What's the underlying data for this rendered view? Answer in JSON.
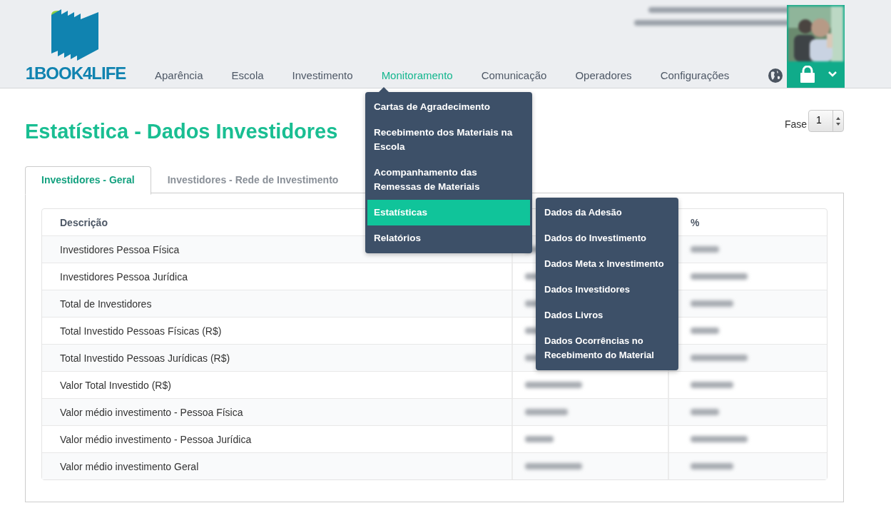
{
  "logo": {
    "text": "1BOOK4LIFE"
  },
  "nav": [
    {
      "label": "Aparência",
      "selected": false
    },
    {
      "label": "Escola",
      "selected": false
    },
    {
      "label": "Investimento",
      "selected": false
    },
    {
      "label": "Monitoramento",
      "selected": true
    },
    {
      "label": "Comunicação",
      "selected": false
    },
    {
      "label": "Operadores",
      "selected": false
    },
    {
      "label": "Configurações",
      "selected": false
    }
  ],
  "menu": {
    "items": [
      {
        "label": "Cartas de Agradecimento",
        "selected": false
      },
      {
        "label": "Recebimento dos Materiais na Escola",
        "selected": false
      },
      {
        "label": "Acompanhamento das Remessas de Materiais",
        "selected": false
      },
      {
        "label": "Estatísticas",
        "selected": true
      },
      {
        "label": "Relatórios",
        "selected": false
      }
    ],
    "submenu": [
      {
        "label": "Dados da Adesão"
      },
      {
        "label": "Dados do Investimento"
      },
      {
        "label": "Dados Meta x Investimento"
      },
      {
        "label": "Dados Investidores"
      },
      {
        "label": "Dados Livros"
      },
      {
        "label": "Dados Ocorrências no Recebimento do Material"
      }
    ]
  },
  "page_title": "Estatística - Dados Investidores",
  "phase": {
    "label": "Fase",
    "value": "1"
  },
  "tabs": [
    {
      "label": "Investidores - Geral",
      "selected": true
    },
    {
      "label": "Investidores - Rede de Investimento",
      "selected": false
    }
  ],
  "table": {
    "columns": [
      "Descrição",
      "",
      "%"
    ],
    "rows": [
      "Investidores Pessoa Física",
      "Investidores Pessoa Jurídica",
      "Total de Investidores",
      "Total Investido Pessoas Físicas (R$)",
      "Total Investido Pessoas Jurídicas (R$)",
      "Valor Total Investido (R$)",
      "Valor médio investimento - Pessoa Física",
      "Valor médio investimento - Pessoa Jurídica",
      "Valor médio investimento Geral"
    ]
  }
}
